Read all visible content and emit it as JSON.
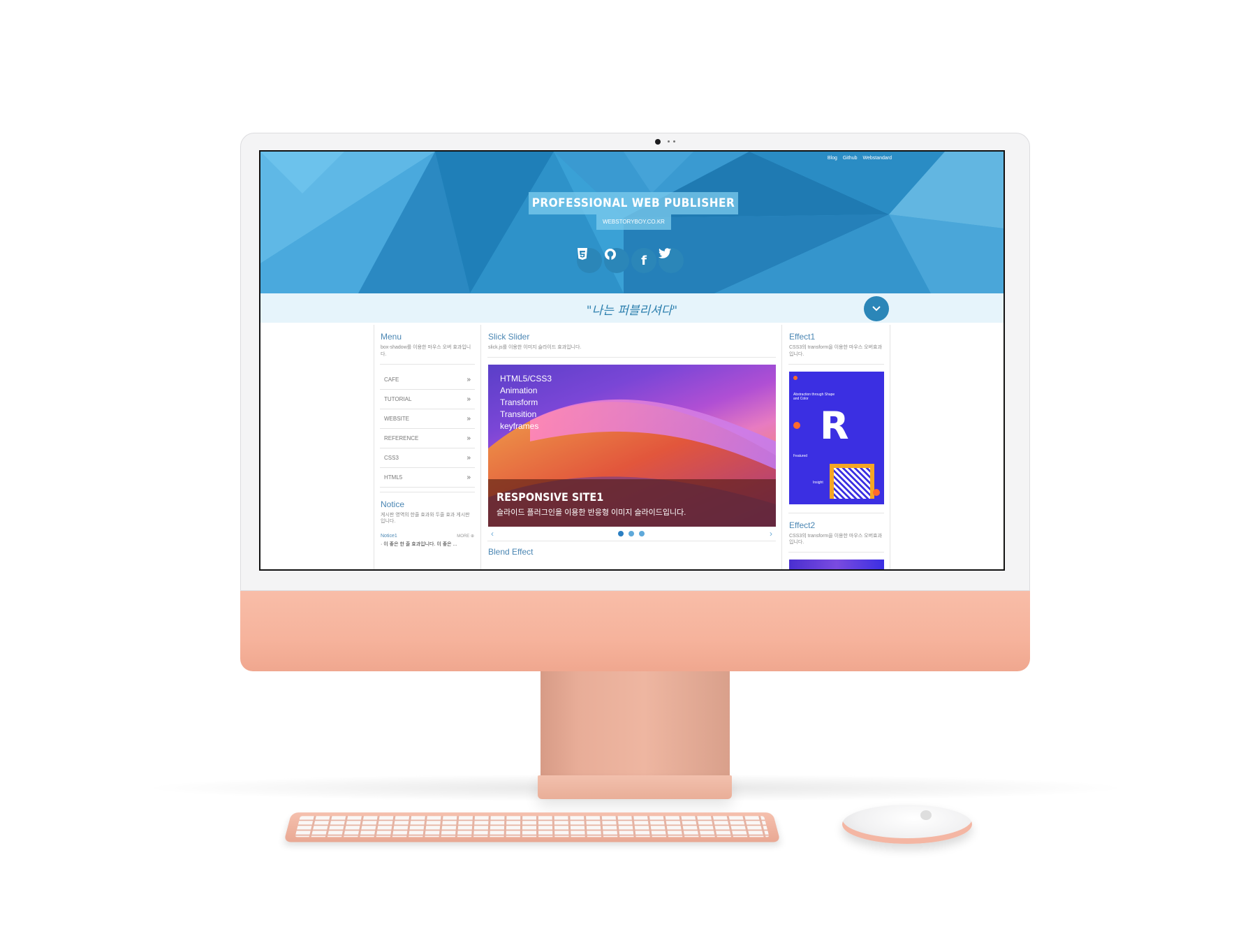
{
  "site": {
    "top_links": [
      "Blog",
      "Github",
      "Webstandard"
    ],
    "hero_title": "PROFESSIONAL WEB PUBLISHER",
    "hero_subtitle": "WEBSTORYBOY.CO.KR",
    "social_icons": [
      "html5-icon",
      "github-icon",
      "facebook-icon",
      "twitter-icon"
    ],
    "motto": "\"나는 퍼블리셔다\""
  },
  "menu": {
    "title": "Menu",
    "desc": "box-shadow를 이용한 마우스 오버 효과입니다.",
    "items": [
      "CAFE",
      "TUTORIAL",
      "WEBSITE",
      "REFERENCE",
      "CSS3",
      "HTML5"
    ]
  },
  "notice": {
    "title": "Notice",
    "desc": "게시판 영역의 한줄 효과와 두줄 효과 게시판입니다.",
    "tab": "Notice1",
    "more": "MORE",
    "line": "· 이 좋은 한 줄 효과입니다. 이 좋은 ..."
  },
  "slider": {
    "title": "Slick Slider",
    "desc": "slick.js를 이용한 이미지 슬라이드 효과입니다.",
    "overlay_lines": [
      "HTML5/CSS3",
      "Animation",
      "Transform",
      "Transition",
      "keyframes"
    ],
    "band_title": "RESPONSIVE SITE1",
    "band_desc": "슬라이드 플러그인을 이용한 반응형 이미지 슬라이드입니다.",
    "dot_count": 3,
    "active_dot": 1
  },
  "blend": {
    "title": "Blend Effect"
  },
  "effect1": {
    "title": "Effect1",
    "desc": "CSS3의 transform을 이용한 마우스 오버효과입니다.",
    "card_heading": "Abstraction through Shape and Color",
    "card_featured": "Featured",
    "card_insight": "Insight",
    "card_letter": "R"
  },
  "effect2": {
    "title": "Effect2",
    "desc": "CSS3의 transform을 이용한 마우스 오버효과입니다."
  },
  "colors": {
    "hero_blue": "#2e93c9",
    "accent_blue": "#2b86b8",
    "imac_peach": "#f6b39c"
  }
}
